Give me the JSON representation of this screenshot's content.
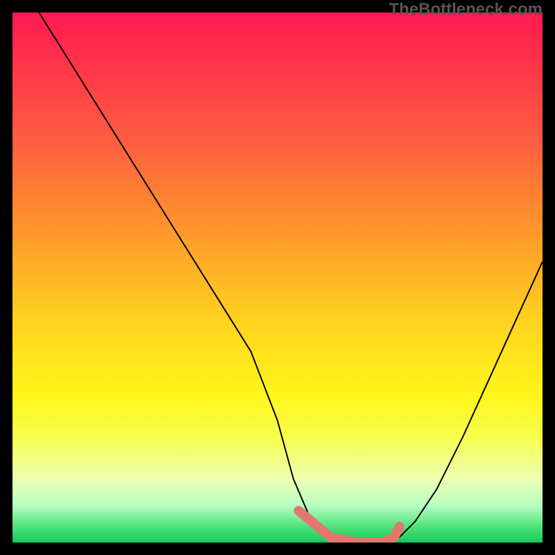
{
  "header": {
    "watermark": "TheBottleneck.com"
  },
  "chart_data": {
    "type": "line",
    "title": "TheBottleneck.com",
    "xlabel": "",
    "ylabel": "",
    "xlim": [
      0,
      100
    ],
    "ylim": [
      0,
      100
    ],
    "grid": false,
    "legend": false,
    "background": "rainbow-vertical-gradient",
    "series": [
      {
        "name": "bottleneck-curve",
        "x": [
          5,
          10,
          15,
          20,
          25,
          30,
          35,
          40,
          45,
          50,
          53,
          56,
          60,
          65,
          70,
          73,
          76,
          80,
          85,
          90,
          95,
          100
        ],
        "values": [
          100,
          92,
          84,
          76,
          68,
          60,
          52,
          44,
          36,
          23,
          12,
          5,
          1,
          0,
          0,
          1,
          4,
          10,
          20,
          31,
          42,
          53
        ]
      },
      {
        "name": "highlight-salmon",
        "color": "#e07870",
        "x": [
          54,
          60,
          65,
          70,
          72,
          73
        ],
        "values": [
          6,
          1,
          0,
          0,
          1,
          3
        ]
      }
    ]
  }
}
